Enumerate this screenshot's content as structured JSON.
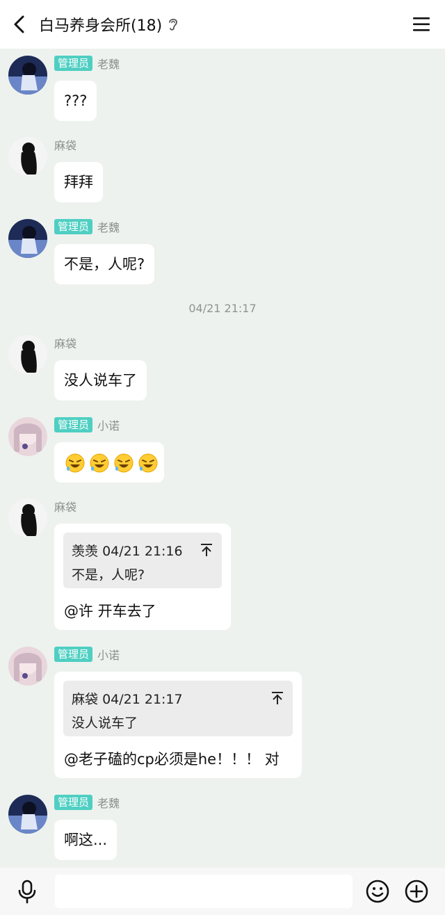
{
  "header": {
    "title": "白马养身会所(18)",
    "back_icon": "chevron-left-icon",
    "ear_icon": "ear-icon",
    "menu_icon": "hamburger-menu-icon"
  },
  "badge_label": "管理员",
  "messages": [
    {
      "sender": "老魏",
      "admin": true,
      "text": "???"
    },
    {
      "sender": "麻袋",
      "admin": false,
      "text": "拜拜"
    },
    {
      "sender": "老魏",
      "admin": true,
      "text": "不是，人呢?"
    },
    {
      "sender": "麻袋",
      "admin": false,
      "text": "没人说车了"
    },
    {
      "sender": "小诺",
      "admin": true,
      "emoji": [
        "laughing-tears-emoji",
        "laughing-tears-emoji",
        "laughing-tears-emoji",
        "laughing-tears-emoji"
      ]
    },
    {
      "sender": "麻袋",
      "admin": false,
      "quote": {
        "author": "羡羡",
        "time": "04/21 21:16",
        "text": "不是，人呢?"
      },
      "text": "@许 开车去了"
    },
    {
      "sender": "小诺",
      "admin": true,
      "quote": {
        "author": "麻袋",
        "time": "04/21 21:17",
        "text": "没人说车了"
      },
      "text": "@老子磕的cp必须是he！！！ 对"
    },
    {
      "sender": "老魏",
      "admin": true,
      "text": "啊这..."
    }
  ],
  "time_separator": "04/21 21:17",
  "composer": {
    "placeholder": "",
    "mic_icon": "microphone-icon",
    "emoji_icon": "smiley-icon",
    "plus_icon": "plus-circle-icon"
  },
  "colors": {
    "background": "#edf2ee",
    "badge": "#4fcfc2",
    "bubble": "#ffffff",
    "quote_bg": "#ececec"
  }
}
